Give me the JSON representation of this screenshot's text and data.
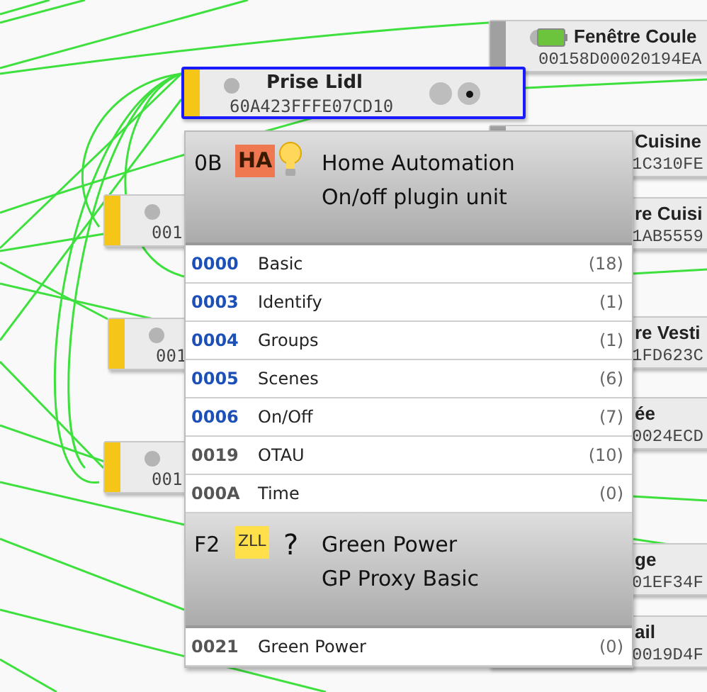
{
  "nodes": [
    {
      "title": "Fenêtre Coule",
      "address": "00158D00020194EA",
      "color": "#a0a0a0",
      "selected": false,
      "battery": true,
      "kind": "right"
    },
    {
      "title": "Prise Lidl",
      "address": "60A423FFFE07CD10",
      "color": "#f5c518",
      "selected": true,
      "battery": false,
      "kind": "main"
    },
    {
      "address": "001",
      "color": "#f5c518",
      "selected": false,
      "battery": false,
      "kind": "left"
    },
    {
      "address": "001",
      "color": "#f5c518",
      "selected": false,
      "battery": false,
      "kind": "left"
    },
    {
      "address": "001",
      "color": "#f5c518",
      "selected": false,
      "battery": false,
      "kind": "left"
    },
    {
      "title": "Cuisine",
      "address": "1C310FE",
      "selected": false,
      "battery": false,
      "kind": "right"
    },
    {
      "title": "re Cuisi",
      "address": "1AB5559",
      "selected": false,
      "battery": false,
      "kind": "right"
    },
    {
      "title": "re Vesti",
      "address": "1FD623C",
      "selected": false,
      "battery": false,
      "kind": "right"
    },
    {
      "title": "ée",
      "address": "0024ECD",
      "selected": false,
      "battery": false,
      "kind": "right"
    },
    {
      "title": "ge",
      "address": "01EF34F",
      "selected": false,
      "battery": false,
      "kind": "right"
    },
    {
      "title": "ail",
      "address": "0019D4F",
      "selected": false,
      "battery": false,
      "kind": "right"
    }
  ],
  "endpoints": [
    {
      "endpoint": "0B",
      "profile": "HA",
      "color": "#f07850",
      "kind": "bulb",
      "title": "Home Automation",
      "device": "On/off plugin unit",
      "clusters": [
        {
          "id": "0000",
          "name": "Basic",
          "count": "(18)",
          "kind": "server"
        },
        {
          "id": "0003",
          "name": "Identify",
          "count": "(1)",
          "kind": "server"
        },
        {
          "id": "0004",
          "name": "Groups",
          "count": "(1)",
          "kind": "server"
        },
        {
          "id": "0005",
          "name": "Scenes",
          "count": "(6)",
          "kind": "server"
        },
        {
          "id": "0006",
          "name": "On/Off",
          "count": "(7)",
          "kind": "server"
        },
        {
          "id": "0019",
          "name": "OTAU",
          "count": "(10)",
          "kind": "client"
        },
        {
          "id": "000A",
          "name": "Time",
          "count": "(0)",
          "kind": "client"
        }
      ]
    },
    {
      "endpoint": "F2",
      "profile": "ZLL",
      "color": "#ffe04a",
      "kind": "unknown",
      "icon_text": "?",
      "title": "Green Power",
      "device": "GP Proxy Basic",
      "clusters": [
        {
          "id": "0021",
          "name": "Green Power",
          "count": "(0)",
          "kind": "client"
        }
      ]
    }
  ]
}
